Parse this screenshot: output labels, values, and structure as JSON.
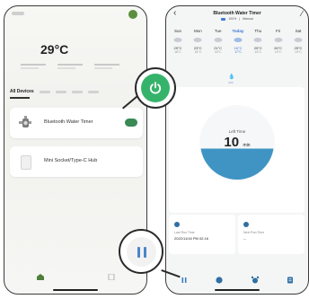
{
  "left_phone": {
    "temperature": "29°C",
    "tabs": {
      "active_label": "All Devices"
    },
    "devices": [
      {
        "name": "Bluetooth Water Timer",
        "toggle_on": true
      },
      {
        "name": "Mini Socket/Type-C Hub"
      }
    ]
  },
  "right_phone": {
    "header": {
      "title": "Bluetooth Water Timer",
      "battery": "100%",
      "mode": "Manual"
    },
    "forecast": [
      {
        "day": "Sun",
        "high": "29°C",
        "low": "18°C"
      },
      {
        "day": "Mon",
        "high": "23°C",
        "low": "18°C"
      },
      {
        "day": "Tue",
        "high": "21°C",
        "low": "18°C"
      },
      {
        "day": "Today",
        "high": "16°C",
        "low": "17°C",
        "today": true
      },
      {
        "day": "Thu",
        "high": "25°C",
        "low": "16°C"
      },
      {
        "day": "Fri",
        "high": "26°C",
        "low": "19°C"
      },
      {
        "day": "Sat",
        "high": "25°C",
        "low": "19°C"
      }
    ],
    "timer": {
      "label": "Left Time",
      "value": "10",
      "unit": "min",
      "remaining_fraction": 0.42
    },
    "last_run": {
      "label": "Last Run Time",
      "value": "2022/11/16 PM 02:16"
    },
    "next_run": {
      "label": "Next Run Time",
      "value": "--"
    }
  },
  "colors": {
    "accent_green": "#36b36b",
    "water_blue": "#3f94c4",
    "today_blue": "#3a76d6"
  },
  "icons": {
    "power": "power-icon",
    "pause": "pause-icon",
    "bottom_bar": [
      "pause-icon",
      "water-drop-icon",
      "alarm-clock-icon",
      "list-icon"
    ]
  }
}
